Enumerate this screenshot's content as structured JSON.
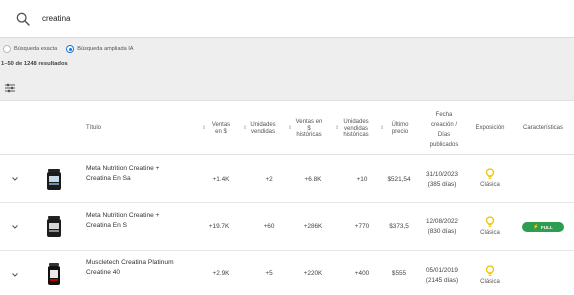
{
  "search": {
    "value": "creatina",
    "placeholder": ""
  },
  "options": {
    "exact_label": "Búsqueda exacta",
    "ai_label": "Búsqueda ampliada IA"
  },
  "results_text": "1–50 de 1248 resultados",
  "headers": {
    "titulo": "Título",
    "ventas_usd": [
      "Ventas",
      "en $"
    ],
    "unidades": [
      "Unidades",
      "vendidas"
    ],
    "ventas_hist": [
      "Ventas en",
      "$",
      "históricas"
    ],
    "unidades_hist": [
      "Unidades",
      "vendidas",
      "históricas"
    ],
    "ultimo_precio": [
      "Último",
      "precio"
    ],
    "fecha": [
      "Fecha",
      "creación /",
      "Días",
      "publicados"
    ],
    "exposicion": "Exposición",
    "caracteristicas": "Características"
  },
  "rows": [
    {
      "title_line1": "Meta Nutrition Creatine +",
      "title_line2": "Creatina En Sa",
      "ventas": "+1.4K",
      "unidades": "+2",
      "ventas_hist": "+6.8K",
      "unidades_hist": "+10",
      "precio": "$521,54",
      "fecha": "31/10/2023",
      "dias": "(385 días)",
      "exposicion": "Clásica",
      "badge": ""
    },
    {
      "title_line1": "Meta Nutrition Creatine +",
      "title_line2": "Creatina En S",
      "ventas": "+19.7K",
      "unidades": "+60",
      "ventas_hist": "+286K",
      "unidades_hist": "+770",
      "precio": "$373,5",
      "fecha": "12/08/2022",
      "dias": "(830 días)",
      "exposicion": "Clásica",
      "badge": "FULL"
    },
    {
      "title_line1": "Muscletech Creatina Platinum",
      "title_line2": "Creatine 40",
      "ventas": "+2.9K",
      "unidades": "+5",
      "ventas_hist": "+220K",
      "unidades_hist": "+400",
      "precio": "$555",
      "fecha": "05/01/2019",
      "dias": "(2145 días)",
      "exposicion": "Clásica",
      "badge": ""
    }
  ],
  "colors": {
    "accent": "#1976d2",
    "bulb": "#f2c200",
    "full_badge": "#2e9d4f"
  },
  "icons": [
    "search-icon",
    "filter-icon",
    "sort-icon",
    "chevron-down-icon",
    "lightbulb-icon",
    "lightning-icon"
  ]
}
